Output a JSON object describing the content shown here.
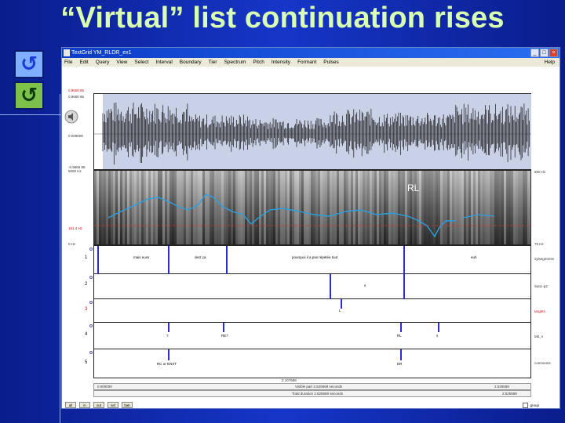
{
  "slide": {
    "title": "“Virtual” list continuation rises"
  },
  "window": {
    "title": "TextGrid YM_RLDR_ex1",
    "menu": [
      "File",
      "Edit",
      "Query",
      "View",
      "Select",
      "Interval",
      "Boundary",
      "Tier",
      "Spectrum",
      "Pitch",
      "Intensity",
      "Formant",
      "Pulses"
    ],
    "help": "Help"
  },
  "axis": {
    "wave_top": "0.9660 95",
    "wave_mid": "0.009609",
    "wave_bottom": "-0.9060",
    "wave_min": "-0.9666 96",
    "spec_top": "5000 Hz",
    "spec_right_top": "500 Hz",
    "pitch_ref": "181.4 Hz",
    "spec_bottom": "0 Hz",
    "spec_right_bottom": "75 Hz"
  },
  "annotation": {
    "rl": "RL"
  },
  "tiers": [
    {
      "num": "1",
      "name": "sylsegments",
      "labels": [
        "s",
        "mais euxs",
        "dect ça",
        "pourquoi il a pas répétée tout",
        "euh"
      ]
    },
    {
      "num": "2",
      "name": "Sanc-p2",
      "labels": [
        "s"
      ]
    },
    {
      "num": "3",
      "name": "targets",
      "labels": [
        "L"
      ]
    },
    {
      "num": "4",
      "name": "tab_s",
      "labels": [
        "?",
        "RE?",
        "RL",
        "s"
      ]
    },
    {
      "num": "5",
      "name": "comments",
      "labels": [
        "RC or ENXT",
        "DR"
      ]
    }
  ],
  "timeline": {
    "start": "0.000000",
    "mid": "2.107668",
    "end": "2.525569",
    "visible": "Visible part 2.525569 seconds",
    "total": "Total duration 2.525569 seconds",
    "zoom_right": "2.525569"
  },
  "bottom_buttons": [
    "all",
    "in",
    "out",
    "sel",
    "bak"
  ],
  "checkbox_label": "group"
}
